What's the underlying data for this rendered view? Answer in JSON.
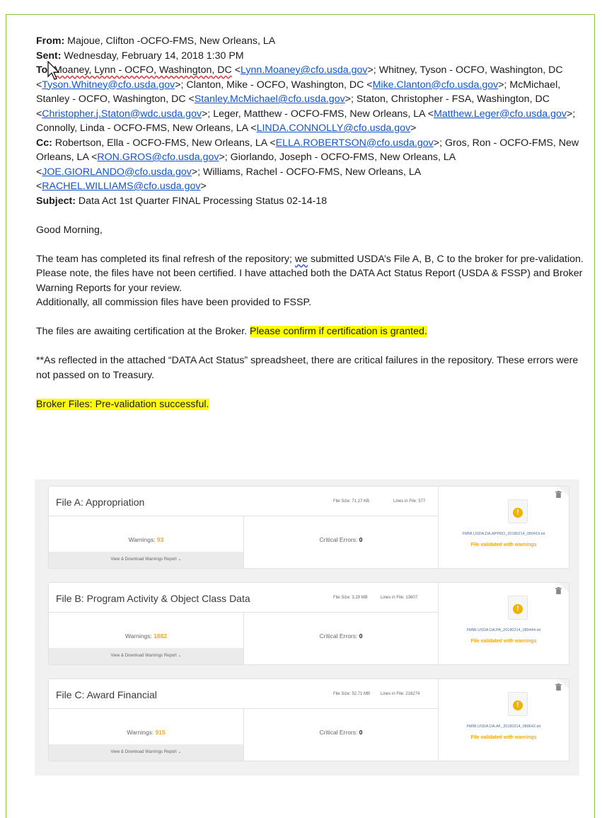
{
  "email": {
    "from_label": "From:",
    "from_value": " Majoue, Clifton -OCFO-FMS, New Orleans, LA",
    "sent_label": "Sent:",
    "sent_value": " Wednesday, February 14, 2018 1:30 PM",
    "to_label": "To:",
    "to_recipients": [
      {
        "name": "Moaney, Lynn - OCFO, Washington, DC",
        "email": "Lynn.Moaney@cfo.usda.gov"
      },
      {
        "name": "Whitney, Tyson - OCFO, Washington, DC",
        "email": "Tyson.Whitney@cfo.usda.gov"
      },
      {
        "name": "Clanton, Mike - OCFO, Washington, DC",
        "email": "Mike.Clanton@cfo.usda.gov"
      },
      {
        "name": "McMichael, Stanley - OCFO, Washington, DC",
        "email": "Stanley.McMichael@cfo.usda.gov"
      },
      {
        "name": "Staton, Christopher - FSA, Washington, DC",
        "email": "Christopher.j.Staton@wdc.usda.gov"
      },
      {
        "name": "Leger, Matthew - OCFO-FMS, New Orleans, LA",
        "email": "Matthew.Leger@cfo.usda.gov"
      },
      {
        "name": "Connolly, Linda - OCFO-FMS, New Orleans, LA",
        "email": "LINDA.CONNOLLY@cfo.usda.gov"
      }
    ],
    "cc_label": "Cc:",
    "cc_recipients": [
      {
        "name": "Robertson, Ella - OCFO-FMS, New Orleans, LA",
        "email": "ELLA.ROBERTSON@cfo.usda.gov"
      },
      {
        "name": "Gros, Ron - OCFO-FMS, New Orleans, LA",
        "email": "RON.GROS@cfo.usda.gov"
      },
      {
        "name": "Giorlando, Joseph - OCFO-FMS, New Orleans, LA",
        "email": "JOE.GIORLANDO@cfo.usda.gov"
      },
      {
        "name": "Williams, Rachel - OCFO-FMS, New Orleans, LA",
        "email": "RACHEL.WILLIAMS@cfo.usda.gov"
      }
    ],
    "subject_label": "Subject:",
    "subject_value": " Data Act 1st Quarter FINAL Processing Status 02-14-18",
    "greeting": "Good Morning,",
    "para1_a": "The team has completed its final refresh of the repository;",
    "para1_we": "we",
    "para1_b": " submitted USDA’s File A, B, C to the broker for pre-validation. Please note, the files have not been certified.  I have attached both the DATA Act Status Report (USDA & FSSP) and Broker Warning Reports for your review.",
    "para1_c": "Additionally, all commission files have been provided to FSSP.",
    "para2": "The files are awaiting certification at the Broker.  ",
    "para2_highlight": "Please confirm if certification is granted.",
    "para3": "**As reflected in the attached “DATA Act Status” spreadsheet, there are critical failures in the repository.  These errors were not passed on to Treasury.",
    "broker_line": "Broker Files: Pre-validation successful."
  },
  "broker": {
    "files": [
      {
        "title": "File A: Appropriation",
        "file_size": "File Size: 71.17 KB",
        "lines": "Lines in File: 577",
        "warnings_label": "Warnings: ",
        "warnings": "93",
        "critical_label": "Critical Errors: ",
        "critical": "0",
        "download": "View & Download Warnings Report ⌄",
        "file_name": "FMMI.USDA.DA.APPRO_20180214_080419.txt",
        "status": "File validated with warnings"
      },
      {
        "title": "File B: Program Activity & Object Class Data",
        "file_size": "File Size: 3.29 MB",
        "lines": "Lines in File: 13607",
        "warnings_label": "Warnings: ",
        "warnings": "1882",
        "critical_label": "Critical Errors: ",
        "critical": "0",
        "download": "View & Download Warnings Report ⌄",
        "file_name": "FMMI.USDA.DA.PA_20180214_080444.txt",
        "status": "File validated with warnings"
      },
      {
        "title": "File C: Award Financial",
        "file_size": "File Size: 52.71 MB",
        "lines": "Lines in File: 218274",
        "warnings_label": "Warnings: ",
        "warnings": "915",
        "critical_label": "Critical Errors: ",
        "critical": "0",
        "download": "View & Download Warnings Report ⌄",
        "file_name": "FMMI.USDA.DA.AF_20180214_080642.txt",
        "status": "File validated with warnings"
      }
    ]
  },
  "colors": {
    "link": "#1155cc",
    "highlight": "#ffff00",
    "warning": "#f0a81e",
    "frame": "#8cc63f"
  }
}
